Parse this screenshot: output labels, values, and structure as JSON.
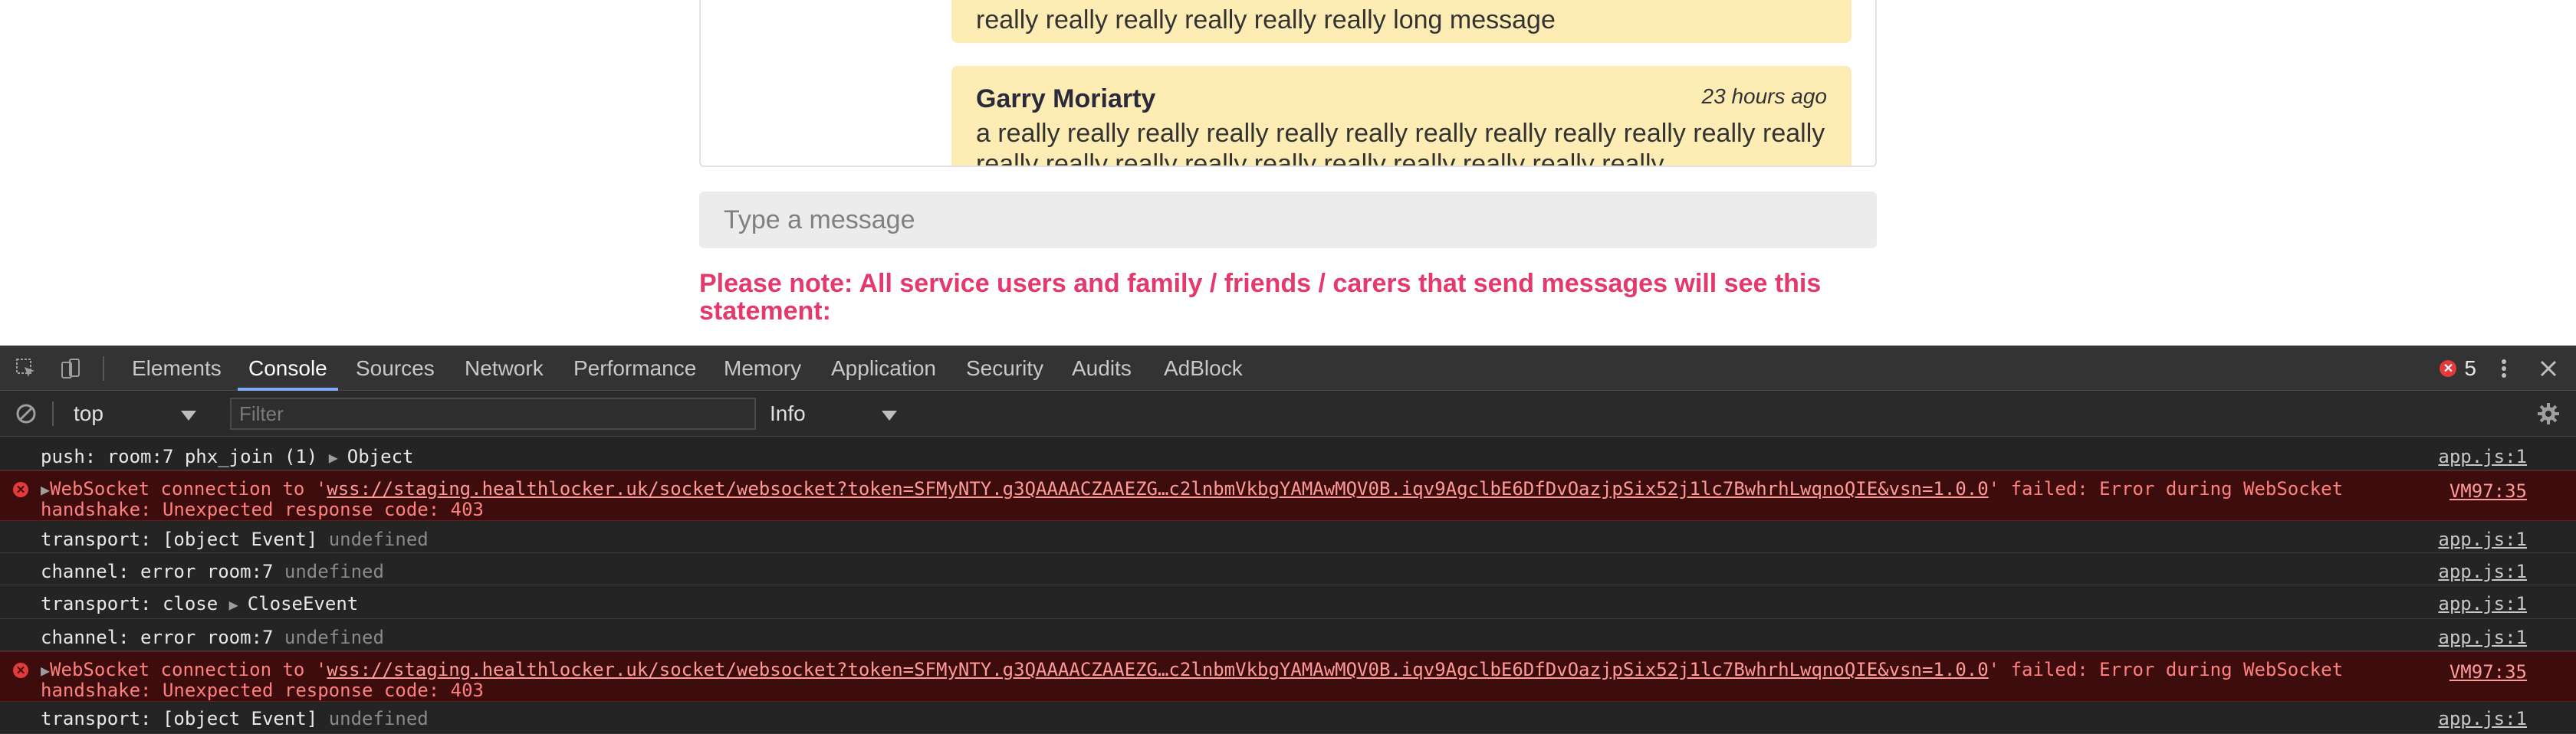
{
  "chat": {
    "messages": [
      {
        "text": "really really really really really really long message"
      },
      {
        "author": "Garry Moriarty",
        "time": "23 hours ago",
        "text": "a really really really really really really really really really really really really really really really really really really really really really really"
      }
    ],
    "input_placeholder": "Type a message",
    "notice": "Please note: All service users and family / friends / carers that send messages will see this statement:"
  },
  "devtools": {
    "tabs": [
      "Elements",
      "Console",
      "Sources",
      "Network",
      "Performance",
      "Memory",
      "Application",
      "Security",
      "Audits",
      "AdBlock"
    ],
    "active_tab": "Console",
    "error_count": "5",
    "context": "top",
    "filter_placeholder": "Filter",
    "level": "Info",
    "colors": {
      "background": "#242424",
      "tabbar": "#333333",
      "error_bg": "#3d0c0c",
      "error_text": "#ff8080",
      "active_tab_indicator": "#7cacf8"
    },
    "console": [
      {
        "type": "log",
        "text": "push: room:7 phx_join (1) ",
        "expand": "Object",
        "source": "app.js:1"
      },
      {
        "type": "error",
        "prefix": "WebSocket connection to '",
        "url": "wss://staging.healthlocker.uk/socket/websocket?token=SFMyNTY.g3QAAAACZAAEZG…c2lnbmVkbgYAMAwMQV0B.iqv9AgclbE6DfDvOazjpSix52j1lc7BwhrhLwqnoQIE&vsn=1.0.0",
        "suffix": "' failed: Error during WebSocket handshake: Unexpected response code: 403",
        "source": "VM97:35"
      },
      {
        "type": "log",
        "text": "transport: [object Event] ",
        "undef": "undefined",
        "source": "app.js:1"
      },
      {
        "type": "log",
        "text": "channel: error room:7 ",
        "undef": "undefined",
        "source": "app.js:1"
      },
      {
        "type": "log",
        "text": "transport: close ",
        "expand": "CloseEvent",
        "source": "app.js:1"
      },
      {
        "type": "log",
        "text": "channel: error room:7 ",
        "undef": "undefined",
        "source": "app.js:1"
      },
      {
        "type": "error",
        "prefix": "WebSocket connection to '",
        "url": "wss://staging.healthlocker.uk/socket/websocket?token=SFMyNTY.g3QAAAACZAAEZG…c2lnbmVkbgYAMAwMQV0B.iqv9AgclbE6DfDvOazjpSix52j1lc7BwhrhLwqnoQIE&vsn=1.0.0",
        "suffix": "' failed: Error during WebSocket handshake: Unexpected response code: 403",
        "source": "VM97:35"
      },
      {
        "type": "log",
        "text": "transport: [object Event] ",
        "undef": "undefined",
        "source": "app.js:1"
      }
    ]
  }
}
